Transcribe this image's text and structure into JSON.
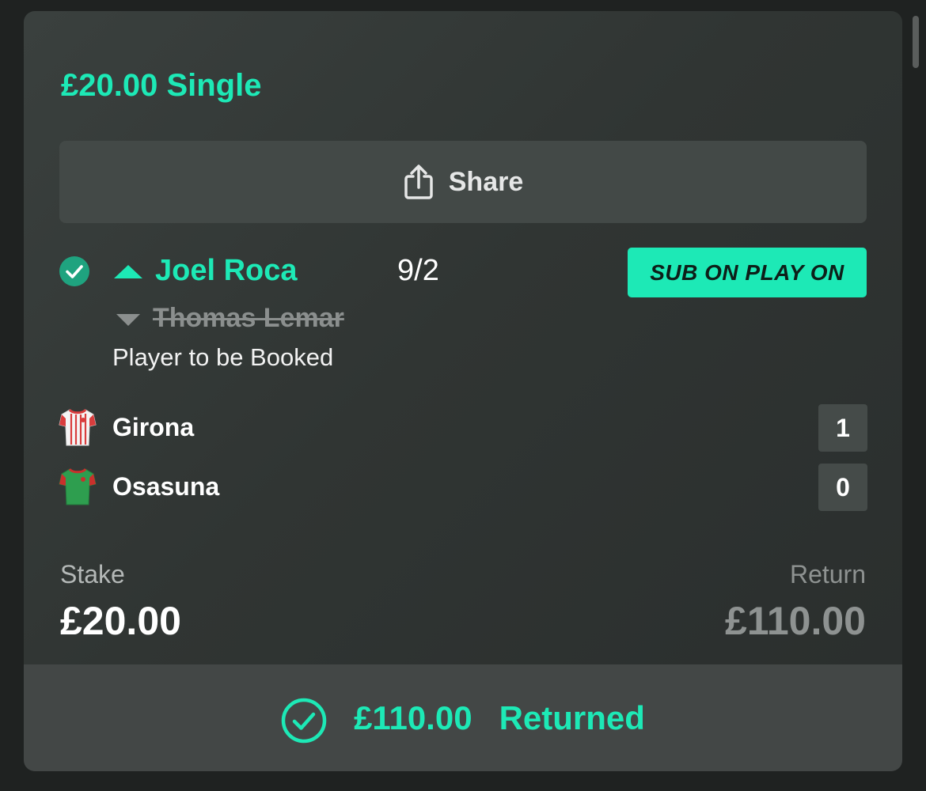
{
  "bet": {
    "title": "£20.00 Single"
  },
  "share": {
    "label": "Share",
    "icon": "share-icon"
  },
  "selection": {
    "status_icon": "check-circle-icon",
    "player_in": "Joel Roca",
    "player_in_icon": "arrow-up-icon",
    "odds": "9/2",
    "badge": "SUB ON PLAY ON",
    "player_out": "Thomas Lemar",
    "player_out_icon": "arrow-down-icon",
    "market": "Player to be Booked"
  },
  "match": {
    "teams": [
      {
        "name": "Girona",
        "score": "1",
        "shirt": "girona-shirt-icon"
      },
      {
        "name": "Osasuna",
        "score": "0",
        "shirt": "osasuna-shirt-icon"
      }
    ]
  },
  "summary": {
    "stake_label": "Stake",
    "stake_value": "£20.00",
    "return_label": "Return",
    "return_value": "£110.00"
  },
  "footer": {
    "icon": "check-circle-icon",
    "amount": "£110.00",
    "status": "Returned"
  },
  "colors": {
    "accent": "#1de9b6",
    "card": "#303533",
    "muted": "#8e9291"
  }
}
